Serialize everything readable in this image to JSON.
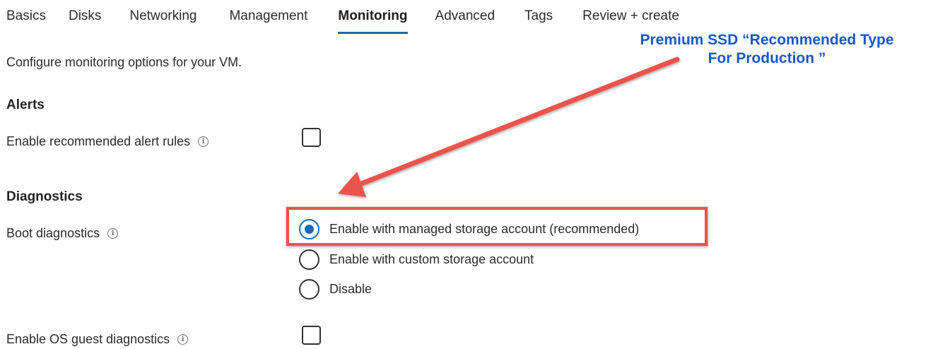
{
  "tabs": [
    {
      "label": "Basics",
      "active": false
    },
    {
      "label": "Disks",
      "active": false
    },
    {
      "label": "Networking",
      "active": false
    },
    {
      "label": "Management",
      "active": false
    },
    {
      "label": "Monitoring",
      "active": true
    },
    {
      "label": "Advanced",
      "active": false
    },
    {
      "label": "Tags",
      "active": false
    },
    {
      "label": "Review + create",
      "active": false
    }
  ],
  "description": "Configure monitoring options for your VM.",
  "alerts": {
    "heading": "Alerts",
    "enable_alert_rules": {
      "label": "Enable recommended alert rules",
      "checked": false,
      "info_icon": "info-icon"
    }
  },
  "diagnostics": {
    "heading": "Diagnostics",
    "boot_diagnostics": {
      "label": "Boot diagnostics",
      "info_icon": "info-icon",
      "options": [
        {
          "label": "Enable with managed storage account (recommended)",
          "selected": true
        },
        {
          "label": "Enable with custom storage account",
          "selected": false
        },
        {
          "label": "Disable",
          "selected": false
        }
      ]
    },
    "os_guest_diagnostics": {
      "label": "Enable OS guest diagnostics",
      "checked": false,
      "info_icon": "info-icon"
    }
  },
  "annotation": {
    "line1": "Premium SSD “Recommended Type",
    "line2": "For Production ”",
    "color": "#1a56c4",
    "arrow_color": "#ec534b"
  },
  "colors": {
    "accent": "#0f6cbd",
    "highlight": "#ec534b"
  }
}
